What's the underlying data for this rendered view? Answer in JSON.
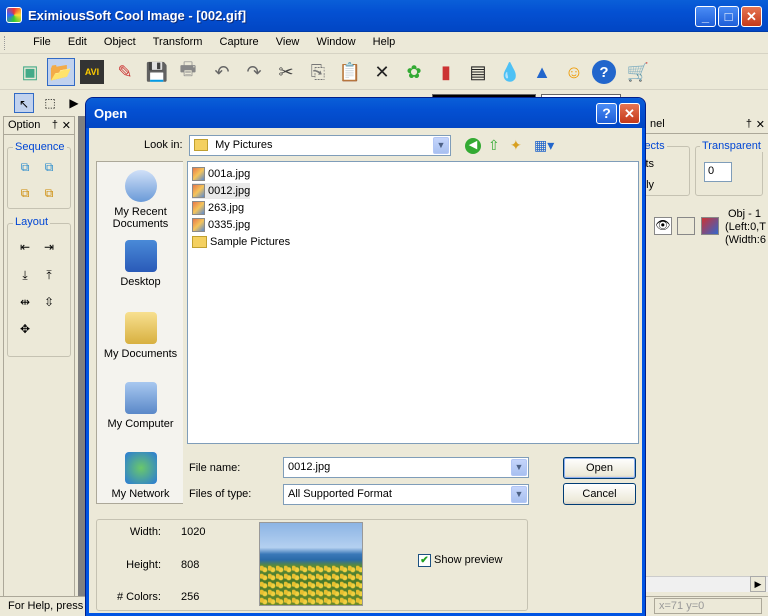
{
  "app": {
    "title": "EximiousSoft Cool Image - [002.gif]",
    "window_buttons": {
      "minimize": "_",
      "maximize": "□",
      "close": "✕"
    }
  },
  "menu": [
    "File",
    "Edit",
    "Object",
    "Transform",
    "Capture",
    "View",
    "Window",
    "Help"
  ],
  "toolbar_icons": [
    "new-icon",
    "open-icon",
    "avi-icon",
    "edit-icon",
    "save-icon",
    "print-icon",
    "undo-icon",
    "redo-icon",
    "cut-icon",
    "copy-icon",
    "paste-icon",
    "delete-icon",
    "effect-icon",
    "chart-icon",
    "filmstrip-icon",
    "drop-icon",
    "triangle-icon",
    "person-icon",
    "help-icon",
    "cart-icon"
  ],
  "toolbar_avi_label": "AVI",
  "left_panel": {
    "title": "Option",
    "pin": "†",
    "close": "✕",
    "sequence_label": "Sequence",
    "layout_label": "Layout"
  },
  "right_panel": {
    "title_fragment": "nel",
    "pin": "†",
    "close": "✕",
    "objects_label": "jects",
    "row1": "cts",
    "row2": "nly",
    "transparent_label": "Transparent",
    "transparent_value": "0",
    "obj_line1": "Obj - 1",
    "obj_line2": "(Left:0,T",
    "obj_line3": "(Width:6"
  },
  "status": {
    "help_text": "For Help, press",
    "coords": "x=71 y=0"
  },
  "dialog": {
    "title": "Open",
    "help_btn": "?",
    "close_btn": "✕",
    "look_in_label": "Look in:",
    "look_in_value": "My Pictures",
    "places": [
      "My Recent Documents",
      "Desktop",
      "My Documents",
      "My Computer",
      "My Network"
    ],
    "files": [
      {
        "name": "001a.jpg",
        "type": "image",
        "selected": false
      },
      {
        "name": "0012.jpg",
        "type": "image",
        "selected": true
      },
      {
        "name": "263.jpg",
        "type": "image",
        "selected": false
      },
      {
        "name": "0335.jpg",
        "type": "image",
        "selected": false
      },
      {
        "name": "Sample Pictures",
        "type": "folder",
        "selected": false
      }
    ],
    "file_name_label": "File name:",
    "file_name_value": "0012.jpg",
    "file_type_label": "Files of type:",
    "file_type_value": "All Supported Format",
    "open_btn": "Open",
    "cancel_btn": "Cancel",
    "preview": {
      "width_label": "Width:",
      "width_value": "1020",
      "height_label": "Height:",
      "height_value": "808",
      "colors_label": "# Colors:",
      "colors_value": "256",
      "show_preview_label": "Show preview",
      "show_preview_checked": true
    }
  }
}
